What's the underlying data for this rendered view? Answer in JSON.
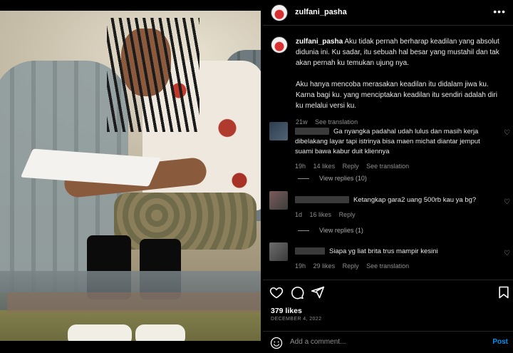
{
  "post": {
    "username": "zulfani_pasha",
    "more_icon": "more-options-icon",
    "caption_username": "zulfani_pasha",
    "caption_p1": "Aku tidak pernah berharap keadilan yang absolut didunia ini. Ku sadar, itu sebuah hal besar yang mustahil dan tak akan pernah ku temukan ujung nya.",
    "caption_p2": "Aku hanya mencoba merasakan keadilan itu didalam jiwa ku. Karna bagi ku. yang menciptakan keadilan itu sendiri adalah diri ku melalui versi ku.",
    "caption_time": "21w",
    "caption_translate": "See translation"
  },
  "comments": [
    {
      "text": "Ga nyangka padahal udah lulus dan masih kerja dibelakang layar tapi istrinya bisa maen michat diantar jemput suami bawa kabur duit kliennya",
      "time": "19h",
      "likes": "14 likes",
      "reply": "Reply",
      "translate": "See translation",
      "view_replies": "View replies (10)"
    },
    {
      "text": "Ketangkap gara2 uang 500rb kau ya bg?",
      "time": "1d",
      "likes": "16 likes",
      "reply": "Reply",
      "view_replies": "View replies (1)"
    },
    {
      "text": "Siapa yg liat brita trus mampir kesini",
      "time": "19h",
      "likes": "29 likes",
      "reply": "Reply",
      "translate": "See translation"
    }
  ],
  "footer": {
    "likes": "379 likes",
    "date": "DECEMBER 4, 2022",
    "add_comment_placeholder": "Add a comment...",
    "post_label": "Post"
  },
  "colors": {
    "background": "#000000",
    "accent": "#0095f6",
    "muted": "#8e8e8e"
  }
}
